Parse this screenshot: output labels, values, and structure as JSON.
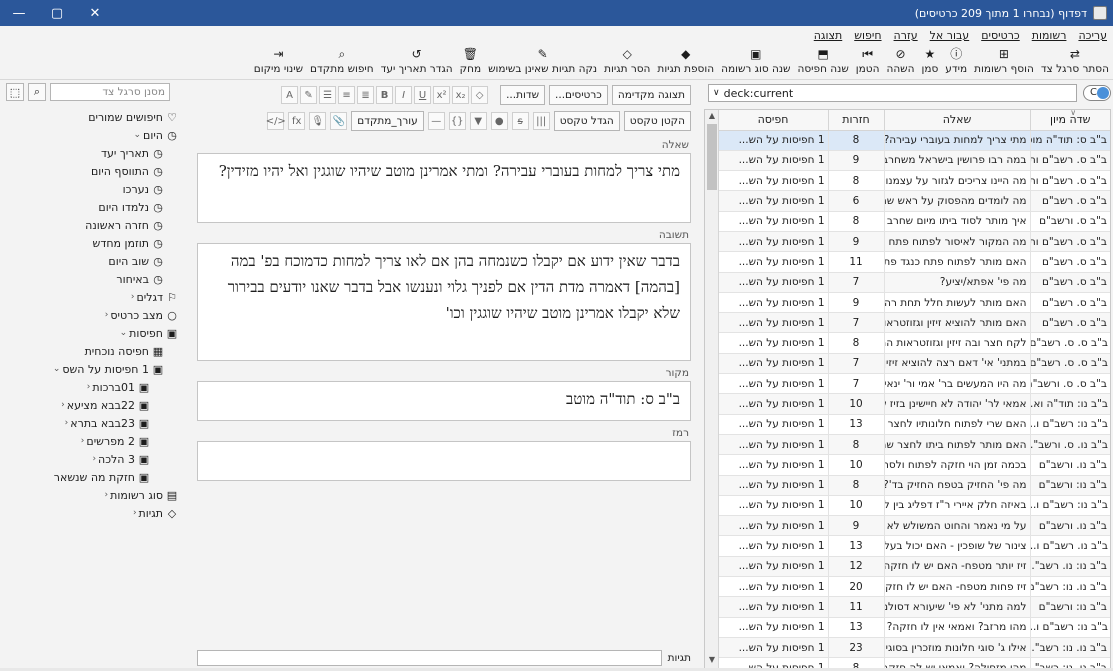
{
  "window": {
    "title": "דפדוף (נבחרו 1 מתוך 209 כרטיסים)",
    "controls": [
      "—",
      "▢",
      "✕"
    ]
  },
  "menu": [
    "עריכה",
    "רשומות",
    "כרטיסים",
    "עבור אל",
    "עזרה",
    "חיפוש",
    "תצוגה"
  ],
  "toolbar": [
    {
      "icon": "⇄",
      "label": "הסתר סרגל צד"
    },
    {
      "icon": "⊞",
      "label": "הוסף רשומות"
    },
    {
      "icon": "ⓘ",
      "label": "מידע"
    },
    {
      "icon": "★",
      "label": "סמן"
    },
    {
      "icon": "⊘",
      "label": "השהה"
    },
    {
      "icon": "⏮",
      "label": "הטמן"
    },
    {
      "icon": "⬒",
      "label": "שנה חפיסה"
    },
    {
      "icon": "▣",
      "label": "שנה סוג רשומה"
    },
    {
      "icon": "◆",
      "label": "הוספת תגיות"
    },
    {
      "icon": "◇",
      "label": "הסר תגיות"
    },
    {
      "icon": "✎",
      "label": "נקה תגיות שאינן בשימוש"
    },
    {
      "icon": "🗑",
      "label": "מחק"
    },
    {
      "icon": "↺",
      "label": "הגדר תאריך יעד"
    },
    {
      "icon": "⌕",
      "label": "חיפוש מתקדם"
    },
    {
      "icon": "⇥",
      "label": "שינוי מיקום"
    }
  ],
  "search": {
    "toggle_label": "C",
    "query": "deck:current"
  },
  "table": {
    "columns": [
      "שדה מיון",
      "שאלה",
      "חזרות",
      "חפיסה"
    ],
    "rows": [
      {
        "sort": "ב\"ב ס: תוד\"ה מוטב",
        "question": "מתי צריך למחות בעוברי עבירה? ומת...",
        "reps": "8",
        "deck": "1 חפיסות על הש..."
      },
      {
        "sort": "ב\"ב ס. רשב\"ם ות...",
        "question": "במה רבו פרושין בישראל משחרב הב...",
        "reps": "9",
        "deck": "1 חפיסות על הש..."
      },
      {
        "sort": "ב\"ב ס. רשב\"ם ות...",
        "question": "מה היינו צריכים לגזור על עצמנו מש...",
        "reps": "8",
        "deck": "1 חפיסות על הש..."
      },
      {
        "sort": "ב\"ב ס. רשב\"ם",
        "question": "מה לומדים מהפסוק על ראש שמחתי?",
        "reps": "6",
        "deck": "1 חפיסות על הש..."
      },
      {
        "sort": "ב\"ב ס. ורשב\"ם",
        "question": "איך מותר לסוד ביתו מיום שחרב ביה...",
        "reps": "8",
        "deck": "1 חפיסות על הש..."
      },
      {
        "sort": "ב\"ב ס. רשב\"ם ות...",
        "question": "מה המקור לאיסור לפתוח פתח כנגד...",
        "reps": "9",
        "deck": "1 חפיסות על הש..."
      },
      {
        "sort": "ב\"ב ס. רשב\"ם",
        "question": "האם מותר לפתוח פתח כנגד פתח ו...",
        "reps": "11",
        "deck": "1 חפיסות על הש..."
      },
      {
        "sort": "ב\"ב ס. רשב\"ם",
        "question": "מה פי' אפתא/יציע?",
        "reps": "7",
        "deck": "1 חפיסות על הש..."
      },
      {
        "sort": "ב\"ב ס. רשב\"ם",
        "question": "האם מותר לעשות חלל תחת רה\"ר? ...",
        "reps": "9",
        "deck": "1 חפיסות על הש..."
      },
      {
        "sort": "ב\"ב ס. רשב\"ם",
        "question": "האם מותר להוציא זיזין וגזוזטראות ל...",
        "reps": "7",
        "deck": "1 חפיסות על הש..."
      },
      {
        "sort": "ב\"ב ס. ס. רשב\"ם...",
        "question": "לקח חצר ובה זיזין וגזוזטראות הרי זו ...",
        "reps": "8",
        "deck": "1 חפיסות על הש..."
      },
      {
        "sort": "ב\"ב ס. ס. רשב\"ם",
        "question": "במתני' אי' דאם רצה להוציא זיזין לחו...",
        "reps": "7",
        "deck": "1 חפיסות על הש..."
      },
      {
        "sort": "ב\"ב ס. ס. ורשב\"ם",
        "question": "מה היו המעשים בר' אמי ור' ינאי שיצ...",
        "reps": "7",
        "deck": "1 חפיסות על הש..."
      },
      {
        "sort": "ב\"ב נו: תוד\"ה וא...",
        "question": "אמאי לר' יהודה לא חיישינן בזיז שבע...",
        "reps": "10",
        "deck": "1 חפיסות על הש..."
      },
      {
        "sort": "ב\"ב נו: רשב\"ם ו...",
        "question": "האם שרי לפתוח חלונותיו לחצר שהו...",
        "reps": "13",
        "deck": "1 חפיסות על הש..."
      },
      {
        "sort": "ב\"ב נו. ס. ורשב\"...",
        "question": "האם מותר לפתוח ביתו לחצר שהוא ...",
        "reps": "8",
        "deck": "1 חפיסות על הש..."
      },
      {
        "sort": "ב\"ב נו. ורשב\"ם",
        "question": "בכמה זמן הוי חזקה לפתוח ולסתום ...",
        "reps": "10",
        "deck": "1 חפיסות על הש..."
      },
      {
        "sort": "ב\"ב נו: ורשב\"ם",
        "question": "מה פי' החזיק בטפח החזיק בד'? [גבי ...",
        "reps": "8",
        "deck": "1 חפיסות על הש..."
      },
      {
        "sort": "ב\"ב נו: רשב\"ם ו...",
        "question": "באיזה חלק איירי ר\"ז דפליג בין למטה ...",
        "reps": "10",
        "deck": "1 חפיסות על הש..."
      },
      {
        "sort": "ב\"ב נו. ורשב\"ם",
        "question": "על מי נאמר והחוט המשולש לא במה...",
        "reps": "9",
        "deck": "1 חפיסות על הש..."
      },
      {
        "sort": "ב\"ב נו. רשב\"ם ו...",
        "question": "צינור של שופכין - האם יכול בעל החצ...",
        "reps": "13",
        "deck": "1 חפיסות על הש..."
      },
      {
        "sort": "ב\"ב נו: נו. רשב\"...",
        "question": "זיז יותר מטפח- האם יש לו חזקה ויכו...",
        "reps": "12",
        "deck": "1 חפיסות על הש..."
      },
      {
        "sort": "ב\"ב נו. נו: רשב\"ם",
        "question": "זיז פחות מטפח- האם יש לו חזקה ויכ...",
        "reps": "20",
        "deck": "1 חפיסות על הש..."
      },
      {
        "sort": "ב\"ב נו: ורשב\"ם",
        "question": "למה מתני' לא פי' שיעורא דסולם כש...",
        "reps": "11",
        "deck": "1 חפיסות על הש..."
      },
      {
        "sort": "ב\"ב נו: רשב\"ם ו...",
        "question": "מהו מרזב? ואמאי אין לו חזקה? ומה פ...",
        "reps": "13",
        "deck": "1 חפיסות על הש..."
      },
      {
        "sort": "ב\"ב נו. נו: רשב\"...",
        "question": "אילו ג' סוגי חלונות מוזכרין בסוגיין בב...",
        "reps": "23",
        "deck": "1 חפיסות על הש..."
      },
      {
        "sort": "ב\"ב נו. נו: רשב\"...",
        "question": "מהי מזחילה? ואמאי יש לה חזקה? ומ...",
        "reps": "8",
        "deck": "1 חפיסות על הש..."
      }
    ]
  },
  "editor": {
    "notetype_button": "תצוגה מקדימה",
    "cards_button": "כרטיסים...",
    "fields_button": "שדות...",
    "toolbar2_labels": [
      "עורך_מתקדם",
      "הגדל טקסט",
      "הקטן טקסט"
    ],
    "fields": [
      {
        "label": "שאלה",
        "content": "מתי צריך למחות בעוברי עבירה? ומתי אמרינן מוטב שיהיו שוגגין ואל יהיו מזידין?"
      },
      {
        "label": "תשובה",
        "content": "בדבר שאין ידוע אם יקבלו כשנמחה בהן אם לאו צריך למחות כדמוכח בפ' במה [בהמה] דאמרה מדת הדין אם לפניך גלוי ונענשו אבל בדבר שאנו יודעים בבירור שלא יקבלו אמרינן מוטב שיהיו שוגגין וכו'"
      },
      {
        "label": "מקור",
        "content": "ב\"ב ס: תוד\"ה מוטב"
      },
      {
        "label": "רמז",
        "content": ""
      }
    ],
    "tags_label": "תגיות"
  },
  "sidebar": {
    "search_placeholder": "מסנן סרגל צד",
    "items": [
      {
        "icon": "♡",
        "label": "חיפושים שמורים",
        "indent": 0,
        "expander": ""
      },
      {
        "icon": "◷",
        "label": "היום",
        "indent": 0,
        "expander": "⌄"
      },
      {
        "icon": "◷",
        "label": "תאריך יעד",
        "indent": 1,
        "expander": ""
      },
      {
        "icon": "◷",
        "label": "התווסף היום",
        "indent": 1,
        "expander": ""
      },
      {
        "icon": "◷",
        "label": "נערכו",
        "indent": 1,
        "expander": ""
      },
      {
        "icon": "◷",
        "label": "נלמדו היום",
        "indent": 1,
        "expander": ""
      },
      {
        "icon": "◷",
        "label": "חזרה ראשונה",
        "indent": 1,
        "expander": ""
      },
      {
        "icon": "◷",
        "label": "תוזמן מחדש",
        "indent": 1,
        "expander": ""
      },
      {
        "icon": "◷",
        "label": "שוב היום",
        "indent": 1,
        "expander": ""
      },
      {
        "icon": "◷",
        "label": "באיחור",
        "indent": 1,
        "expander": ""
      },
      {
        "icon": "⚐",
        "label": "דגלים",
        "indent": 0,
        "expander": "‹"
      },
      {
        "icon": "○",
        "label": "מצב כרטיס",
        "indent": 0,
        "expander": "‹"
      },
      {
        "icon": "▣",
        "label": "חפיסות",
        "indent": 0,
        "expander": "⌄"
      },
      {
        "icon": "▦",
        "label": "חפיסה נוכחית",
        "indent": 1,
        "expander": ""
      },
      {
        "icon": "▣",
        "label": "1 חפיסות על השס",
        "indent": 1,
        "expander": "⌄"
      },
      {
        "icon": "▣",
        "label": "01ברכות",
        "indent": 2,
        "expander": "‹"
      },
      {
        "icon": "▣",
        "label": "22בבא מציעא",
        "indent": 2,
        "expander": "‹"
      },
      {
        "icon": "▣",
        "label": "23בבא בתרא",
        "indent": 2,
        "expander": "‹"
      },
      {
        "icon": "▣",
        "label": "2 מפרשים",
        "indent": 2,
        "expander": "‹"
      },
      {
        "icon": "▣",
        "label": "3 הלכה",
        "indent": 2,
        "expander": "‹"
      },
      {
        "icon": "▣",
        "label": "חזקת מה שנשאר",
        "indent": 2,
        "expander": ""
      },
      {
        "icon": "▤",
        "label": "סוג רשומות",
        "indent": 0,
        "expander": "‹"
      },
      {
        "icon": "◇",
        "label": "תגיות",
        "indent": 0,
        "expander": "‹"
      }
    ]
  },
  "colors": {
    "titlebar": "#2b579a",
    "selected_row": "#dbe8f7",
    "toggle_knob": "#4a90d9"
  }
}
